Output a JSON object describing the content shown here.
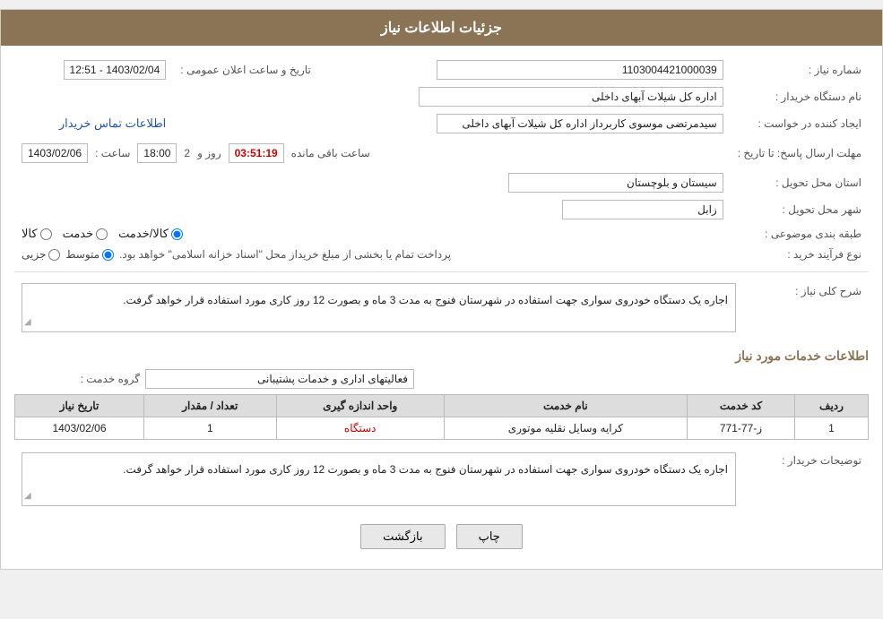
{
  "header": {
    "title": "جزئیات اطلاعات نیاز"
  },
  "fields": {
    "shomara_niaz_label": "شماره نیاز :",
    "shomara_niaz_value": "1103004421000039",
    "name_dastgah_label": "نام دستگاه خریدار :",
    "name_dastgah_value": "اداره کل شیلات آبهای داخلی",
    "ijad_konande_label": "ایجاد کننده در خواست :",
    "ijad_konande_value": "سیدمرتضی موسوی کاربرداز اداره کل شیلات آبهای داخلی",
    "etelaat_link": "اطلاعات تماس خریدار",
    "mohlet_label": "مهلت ارسال پاسخ: تا تاریخ :",
    "date_value": "1403/02/06",
    "saat_label": "ساعت :",
    "saat_value": "18:00",
    "rooz_label": "روز و",
    "rooz_value": "2",
    "baghimande_label": "ساعت باقی مانده",
    "timer_value": "03:51:19",
    "tarikh_aalan_label": "تاریخ و ساعت اعلان عمومی :",
    "tarikh_aalan_value": "1403/02/04 - 12:51",
    "ostan_label": "استان محل تحویل :",
    "ostan_value": "سیستان و بلوچستان",
    "shahr_label": "شهر محل تحویل :",
    "shahr_value": "زابل",
    "tabaghe_label": "طبقه بندی موضوعی :",
    "tabaghe_options": [
      "کالا",
      "خدمت",
      "کالا/خدمت"
    ],
    "tabaghe_selected": "کالا/خدمت",
    "nofarand_label": "نوع فرآیند خرید :",
    "nofarand_options": [
      "جزیی",
      "متوسط"
    ],
    "nofarand_note": "پرداخت تمام یا بخشی از مبلغ خریداز محل \"اسناد خزانه اسلامی\" خواهد بود.",
    "sherh_label": "شرح کلی نیاز :",
    "sherh_value": "اجاره یک دستگاه خودروی سواری جهت استفاده در شهرستان فنوج به مدت 3 ماه و بصورت 12 روز کاری مورد استفاده قرار خواهد گرفت.",
    "khadamat_label": "اطلاعات خدمات مورد نیاز",
    "gorooh_label": "گروه خدمت :",
    "gorooh_value": "فعالیتهای اداری و خدمات پشتیبانی",
    "table": {
      "headers": [
        "ردیف",
        "کد خدمت",
        "نام خدمت",
        "واحد اندازه گیری",
        "تعداد / مقدار",
        "تاریخ نیاز"
      ],
      "rows": [
        {
          "radif": "1",
          "kod": "ز-77-771",
          "naam": "کرایه وسایل نقلیه موتوری",
          "vahed": "دستگاه",
          "tedad": "1",
          "tarikh": "1403/02/06"
        }
      ]
    },
    "tosihaat_label": "توضیحات خریدار :",
    "tosihaat_value": "اجاره یک دستگاه خودروی سواری جهت استفاده در شهرستان فنوج به مدت 3 ماه و بصورت 12 روز کاری مورد استفاده قرار خواهد گرفت."
  },
  "buttons": {
    "print_label": "چاپ",
    "back_label": "بازگشت"
  }
}
